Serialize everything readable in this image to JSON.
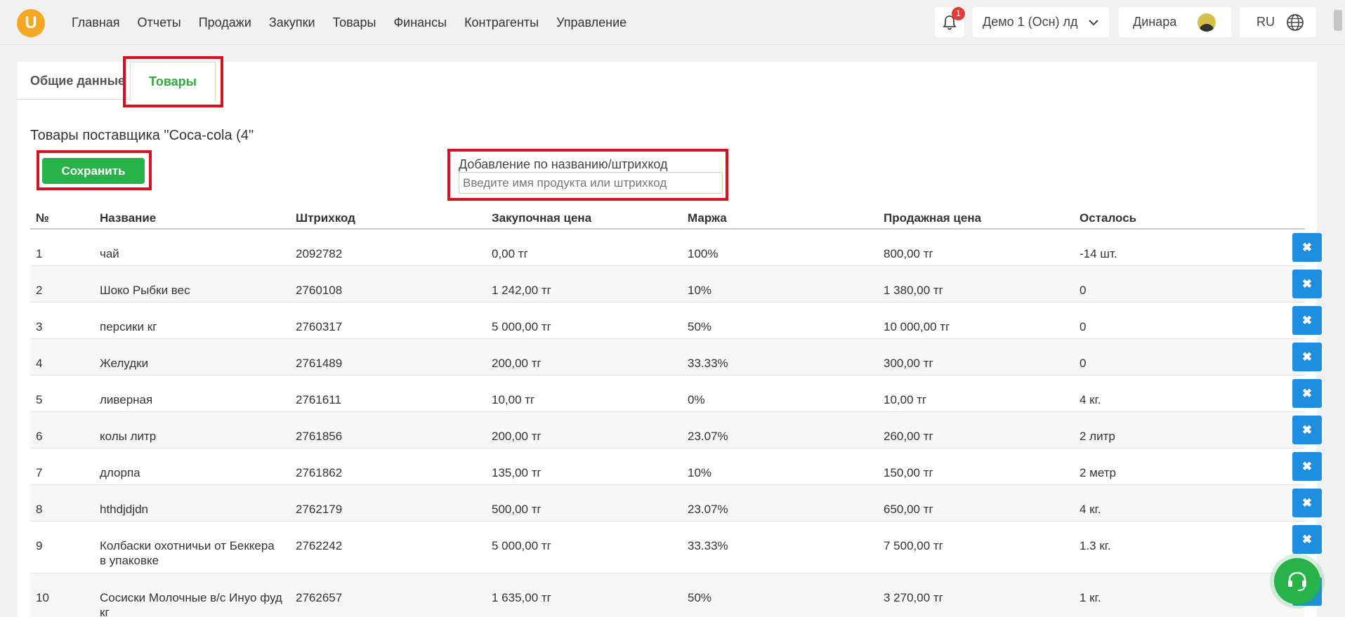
{
  "brand": {
    "logo_letter": "U",
    "accent": "#f5a623",
    "green": "#27b34a",
    "blue": "#1e8ee0",
    "highlight": "#d8101f"
  },
  "nav": [
    "Главная",
    "Отчеты",
    "Продажи",
    "Закупки",
    "Товары",
    "Финансы",
    "Контрагенты",
    "Управление"
  ],
  "header": {
    "notification_count": "1",
    "branch": "Демо 1 (Осн) лд",
    "user": "Динара",
    "language": "RU"
  },
  "tabs": {
    "general": "Общие данные",
    "products": "Товары"
  },
  "page": {
    "title": "Товары поставщика \"Coca-cola (4\"",
    "save_label": "Сохранить",
    "search_label": "Добавление по названию/штрихкод",
    "search_placeholder": "Введите имя продукта или штрихкод"
  },
  "table": {
    "columns": [
      "№",
      "Название",
      "Штрихкод",
      "Закупочная цена",
      "Маржа",
      "Продажная цена",
      "Осталось"
    ],
    "delete_icon": "✖",
    "rows": [
      {
        "num": "1",
        "name": "чай",
        "barcode": "2092782",
        "purchase": "0,00 тг",
        "margin": "100%",
        "sale": "800,00 тг",
        "left": "-14 шт."
      },
      {
        "num": "2",
        "name": "Шоко Рыбки вес",
        "barcode": "2760108",
        "purchase": "1 242,00 тг",
        "margin": "10%",
        "sale": "1 380,00 тг",
        "left": "0"
      },
      {
        "num": "3",
        "name": "персики кг",
        "barcode": "2760317",
        "purchase": "5 000,00 тг",
        "margin": "50%",
        "sale": "10 000,00 тг",
        "left": "0"
      },
      {
        "num": "4",
        "name": "Желудки",
        "barcode": "2761489",
        "purchase": "200,00 тг",
        "margin": "33.33%",
        "sale": "300,00 тг",
        "left": "0"
      },
      {
        "num": "5",
        "name": "ливерная",
        "barcode": "2761611",
        "purchase": "10,00 тг",
        "margin": "0%",
        "sale": "10,00 тг",
        "left": "4 кг."
      },
      {
        "num": "6",
        "name": "колы литр",
        "barcode": "2761856",
        "purchase": "200,00 тг",
        "margin": "23.07%",
        "sale": "260,00 тг",
        "left": "2 литр"
      },
      {
        "num": "7",
        "name": "длорпа",
        "barcode": "2761862",
        "purchase": "135,00 тг",
        "margin": "10%",
        "sale": "150,00 тг",
        "left": "2 метр"
      },
      {
        "num": "8",
        "name": "hthdjdjdn",
        "barcode": "2762179",
        "purchase": "500,00 тг",
        "margin": "23.07%",
        "sale": "650,00 тг",
        "left": "4 кг."
      },
      {
        "num": "9",
        "name": "Колбаски охотничьи от Беккера в упаковке",
        "barcode": "2762242",
        "purchase": "5 000,00 тг",
        "margin": "33.33%",
        "sale": "7 500,00 тг",
        "left": "1.3 кг."
      },
      {
        "num": "10",
        "name": "Сосиски Молочные в/с Инуо фуд кг",
        "barcode": "2762657",
        "purchase": "1 635,00 тг",
        "margin": "50%",
        "sale": "3 270,00 тг",
        "left": "1 кг."
      }
    ]
  }
}
